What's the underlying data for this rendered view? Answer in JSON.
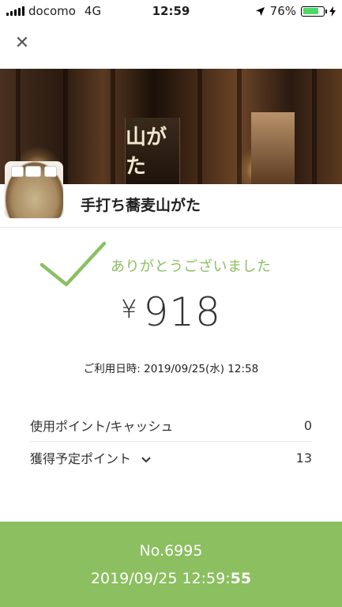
{
  "status_bar": {
    "carrier": "docomo",
    "network": "4G",
    "time": "12:59",
    "battery_percent": "76%",
    "battery_level": 0.76,
    "location_icon": "location-arrow-icon",
    "charging_icon": "bolt-icon"
  },
  "header": {
    "close_icon": "close-icon"
  },
  "store": {
    "name": "手打ち蕎麦山がた",
    "sign_text": "山がた"
  },
  "receipt": {
    "thanks": "ありがとうございました",
    "currency": "¥",
    "amount": "918",
    "usage_label": "ご利用日時: ",
    "usage_datetime": "2019/09/25(水) 12:58",
    "rows": [
      {
        "label": "使用ポイント/キャッシュ",
        "value": "0"
      },
      {
        "label": "獲得予定ポイント",
        "value": "13"
      }
    ]
  },
  "footer": {
    "number": "No.6995",
    "timestamp": "2019/09/25 12:59:",
    "seconds": "55",
    "color": "#8bbf5f"
  },
  "colors": {
    "accent": "#8bc062"
  }
}
